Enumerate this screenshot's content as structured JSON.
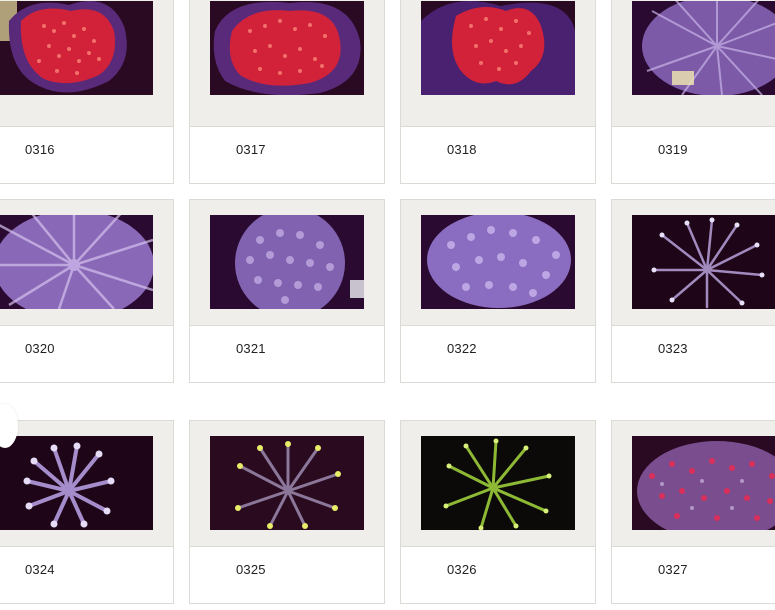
{
  "gallery": {
    "items": [
      {
        "label": "0316",
        "style": "red-encrusting"
      },
      {
        "label": "0317",
        "style": "red-encrusting"
      },
      {
        "label": "0318",
        "style": "red-encrusting"
      },
      {
        "label": "0319",
        "style": "purple-fuzzy"
      },
      {
        "label": "0320",
        "style": "purple-fuzzy"
      },
      {
        "label": "0321",
        "style": "purple-fuzzy"
      },
      {
        "label": "0322",
        "style": "purple-fuzzy"
      },
      {
        "label": "0323",
        "style": "purple-torch"
      },
      {
        "label": "0324",
        "style": "purple-torch"
      },
      {
        "label": "0325",
        "style": "green-tip-torch"
      },
      {
        "label": "0326",
        "style": "green-torch"
      },
      {
        "label": "0327",
        "style": "pink-speckled"
      }
    ]
  },
  "colors": {
    "frame": "#f0eeea",
    "border": "#dcdad5",
    "label_text": "#222222",
    "red_coral": "#d2223a",
    "purple_coral": "#9a7ac8",
    "green_coral": "#9ccc3a",
    "tank_background": "#1a0612"
  }
}
